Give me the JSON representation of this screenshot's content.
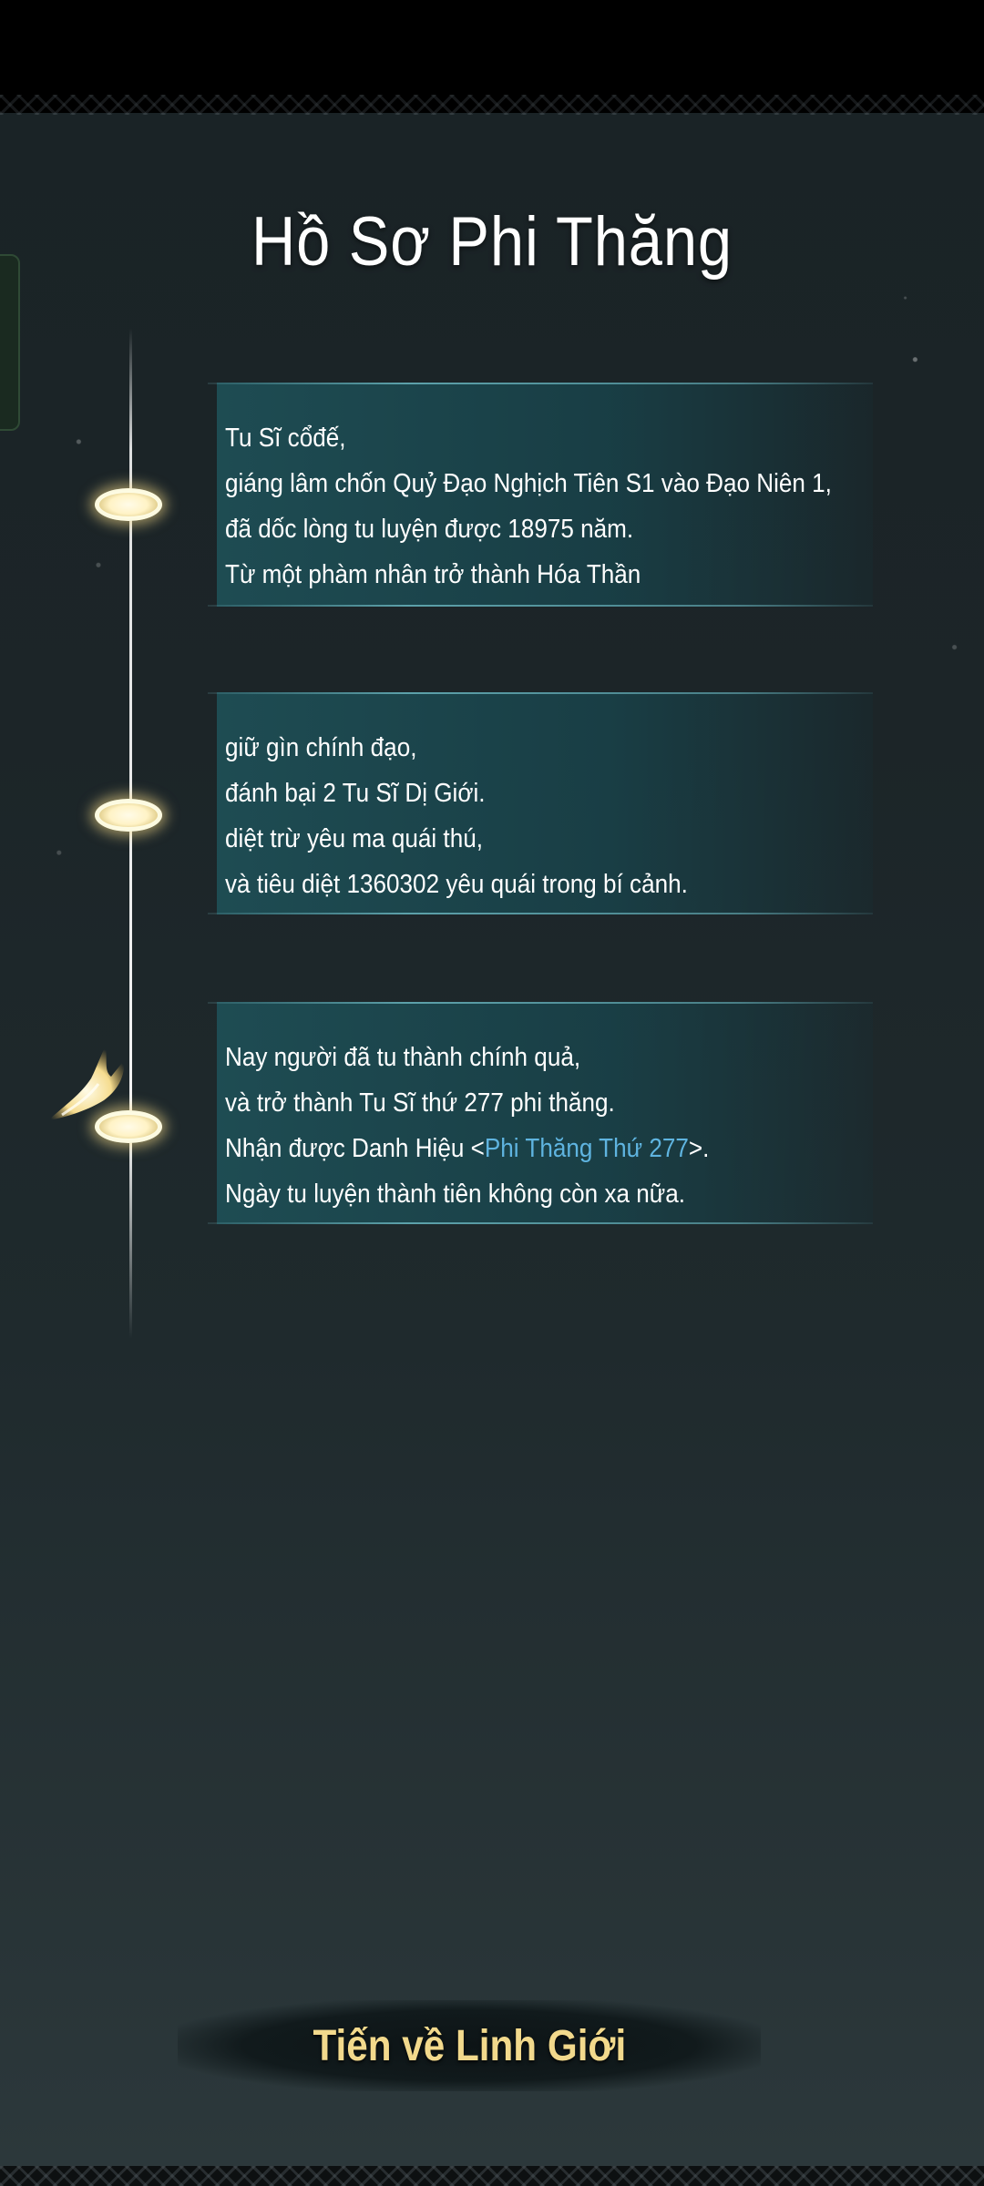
{
  "page": {
    "title": "Hồ Sơ Phi Thăng"
  },
  "timeline": {
    "entries": [
      {
        "lines": [
          "Tu Sĩ cổđế,",
          "giáng lâm chốn Quỷ Đạo Nghịch Tiên S1 vào Đạo Niên 1,",
          "đã dốc lòng tu luyện được 18975 năm.",
          "Từ một phàm nhân trở thành Hóa Thần"
        ]
      },
      {
        "lines": [
          "giữ gìn chính đạo,",
          "đánh bại 2 Tu Sĩ Dị Giới.",
          "diệt trừ yêu ma quái thú,",
          "và tiêu diệt 1360302 yêu quái trong bí cảnh."
        ]
      },
      {
        "lines": [
          "Nay người đã tu thành chính quả,",
          "và trở thành Tu Sĩ thứ 277 phi thăng.",
          "Ngày tu luyện thành tiên không còn xa nữa."
        ],
        "title_line": {
          "prefix": "Nhận được Danh Hiệu <",
          "title": "Phi Thăng Thứ 277",
          "suffix": ">."
        }
      }
    ]
  },
  "action": {
    "label": "Tiến về Linh Giới"
  },
  "colors": {
    "title_highlight": "#5fb4e0",
    "button_text": "#f2d98c"
  }
}
